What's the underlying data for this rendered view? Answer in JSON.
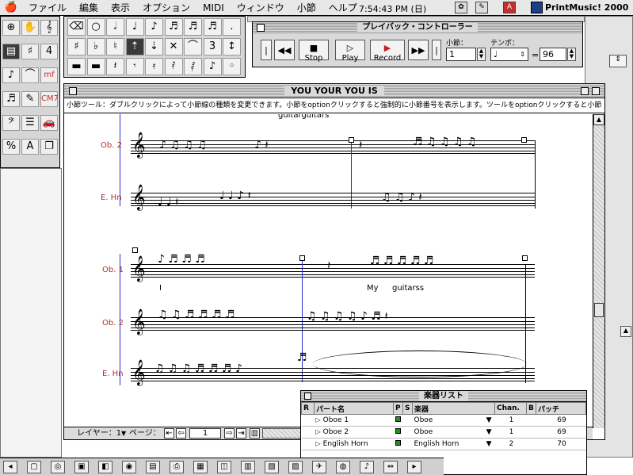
{
  "menubar": {
    "apple": "🍎",
    "menus": [
      "ファイル",
      "編集",
      "表示",
      "オプション",
      "MIDI",
      "ウィンドウ",
      "小節",
      "ヘルプ"
    ],
    "clock": "7:54:43 PM (日)",
    "app_name": "PrintMusic! 2000"
  },
  "tools": [
    {
      "icon": "zoom-icon",
      "glyph": "⊕"
    },
    {
      "icon": "hand-icon",
      "glyph": "✋"
    },
    {
      "icon": "staff-tool-icon",
      "glyph": "𝄞"
    },
    {
      "icon": "measure-tool-icon",
      "glyph": "▤"
    },
    {
      "icon": "key-signature-icon",
      "glyph": "♯"
    },
    {
      "icon": "time-signature-icon",
      "glyph": "4"
    },
    {
      "icon": "simple-entry-icon",
      "glyph": "♪"
    },
    {
      "icon": "slur-icon",
      "glyph": "⌒"
    },
    {
      "icon": "expression-icon",
      "glyph": "mf"
    },
    {
      "icon": "note-mover-icon",
      "glyph": "♬"
    },
    {
      "icon": "articulation-icon",
      "glyph": "✎"
    },
    {
      "icon": "chord-icon",
      "glyph": "CM7"
    },
    {
      "icon": "clef-icon",
      "glyph": "𝄢"
    },
    {
      "icon": "text-block-icon",
      "glyph": "☰"
    },
    {
      "icon": "speedy-entry-icon",
      "glyph": "🚗"
    },
    {
      "icon": "percent-icon",
      "glyph": "%"
    },
    {
      "icon": "text-icon",
      "glyph": "A"
    },
    {
      "icon": "page-layout-icon",
      "glyph": "❐"
    }
  ],
  "notes": [
    {
      "icon": "eraser-icon",
      "glyph": "⌫"
    },
    {
      "icon": "whole-note-icon",
      "glyph": "○"
    },
    {
      "icon": "half-note-icon",
      "glyph": "𝅗𝅥"
    },
    {
      "icon": "quarter-note-icon",
      "glyph": "♩"
    },
    {
      "icon": "eighth-note-icon",
      "glyph": "♪"
    },
    {
      "icon": "sixteenth-note-icon",
      "glyph": "♬"
    },
    {
      "icon": "thirtysecond-note-icon",
      "glyph": "♬"
    },
    {
      "icon": "sixtyfourth-note-icon",
      "glyph": "♬"
    },
    {
      "icon": "dot-icon",
      "glyph": "."
    },
    {
      "icon": "sharp-icon",
      "glyph": "♯"
    },
    {
      "icon": "flat-icon",
      "glyph": "♭"
    },
    {
      "icon": "natural-icon",
      "glyph": "♮"
    },
    {
      "icon": "up-icon",
      "glyph": "⇡"
    },
    {
      "icon": "down-icon",
      "glyph": "⇣"
    },
    {
      "icon": "eraser-note-icon",
      "glyph": "✕"
    },
    {
      "icon": "tie-icon",
      "glyph": "⌒"
    },
    {
      "icon": "tuplet-icon",
      "glyph": "3"
    },
    {
      "icon": "flip-icon",
      "glyph": "↕"
    },
    {
      "icon": "whole-rest-icon",
      "glyph": "▬"
    },
    {
      "icon": "half-rest-icon",
      "glyph": "▬"
    },
    {
      "icon": "quarter-rest-icon",
      "glyph": "𝄽"
    },
    {
      "icon": "eighth-rest-icon",
      "glyph": "𝄾"
    },
    {
      "icon": "sixteenth-rest-icon",
      "glyph": "𝄿"
    },
    {
      "icon": "thirtysecond-rest-icon",
      "glyph": "𝅀"
    },
    {
      "icon": "sixtyfourth-rest-icon",
      "glyph": "𝅁"
    },
    {
      "icon": "grace-icon",
      "glyph": "♪"
    },
    {
      "icon": "void-icon",
      "glyph": "◦"
    }
  ],
  "playback": {
    "title": "プレイバック・コントローラー",
    "stop": "Stop",
    "play": "Play",
    "record": "Record",
    "measure_label": "小節：",
    "measure_value": "1",
    "tempo_label": "テンポ：",
    "tempo_value": "96",
    "equals": "="
  },
  "score": {
    "title": "YOU YOUR YOU IS",
    "message": "小節ツール：ダブルクリックによって小節線の種類を変更できます。小節をoptionクリックすると強制的に小節番号を表示します。ツールをoptionクリックすると小節",
    "lyric_top": "guitarguitars",
    "system1": {
      "label_1": "Ob. 2",
      "label_2": "E. Hn"
    },
    "system2": {
      "label_1": "Ob. 1",
      "label_2": "Ob. 2",
      "label_3": "E. Hn"
    },
    "lyric_I": "I",
    "lyric_My": "My",
    "lyric_guitar": "guitarss",
    "status": {
      "layer": "レイヤー：1",
      "page_label": "ページ：",
      "page_value": "1"
    }
  },
  "instrument_list": {
    "title": "楽器リスト",
    "headers": {
      "r": "R",
      "part": "パート名",
      "p": "P",
      "s": "S",
      "inst": "楽器",
      "chan": "Chan.",
      "b": "B",
      "patch": "パッチ"
    },
    "rows": [
      {
        "part": "Oboe 1",
        "inst": "Oboe",
        "chan": "1",
        "patch": "69"
      },
      {
        "part": "Oboe 2",
        "inst": "Oboe",
        "chan": "1",
        "patch": "69"
      },
      {
        "part": "English Horn",
        "inst": "English Horn",
        "chan": "2",
        "patch": "70"
      }
    ]
  },
  "colors": {
    "instrument_label": "#b03030",
    "selection_line": "#2a2ad0",
    "part_color": "#2a8a2a"
  }
}
